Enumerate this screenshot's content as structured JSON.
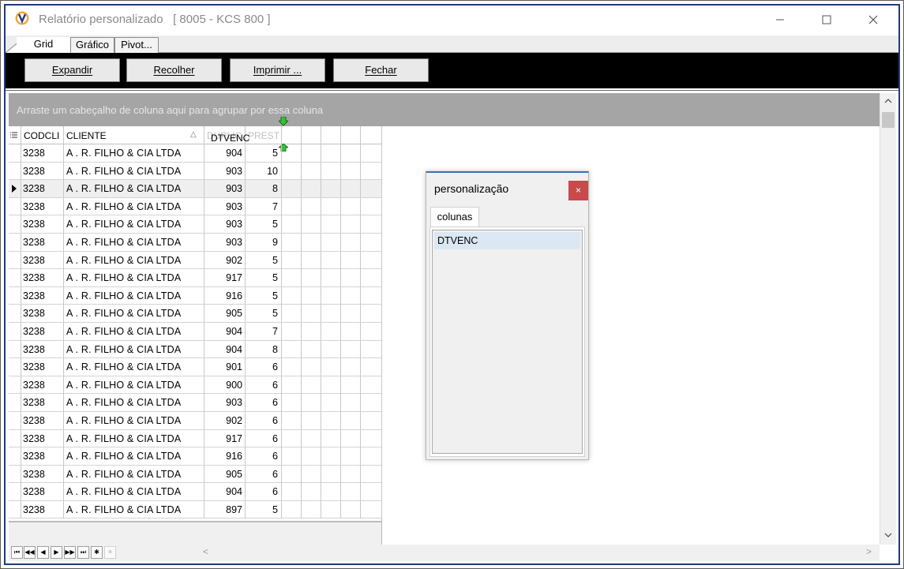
{
  "window": {
    "title": "Relatório personalizado   [ 8005 - KCS 800 ]",
    "controls": [
      "minimize",
      "maximize",
      "close"
    ]
  },
  "tabs": [
    {
      "label": "Grid",
      "active": true
    },
    {
      "label": "Gráfico",
      "active": false
    },
    {
      "label": "Pivot...",
      "active": false
    }
  ],
  "toolbar": {
    "expandir": "Expandir",
    "recolher": "Recolher",
    "imprimir": "Imprimir ...",
    "fechar": "Fechar"
  },
  "group_panel": {
    "hint": "Arraste um cabeçalho de coluna aqui para agrupar por essa coluna"
  },
  "grid": {
    "columns": {
      "codcli": "CODCLI",
      "cliente": "CLIENTE",
      "duplic": "DUPLIC",
      "prest": "PREST"
    },
    "dragging_column": "DTVENC",
    "current_row_index": 2,
    "rows": [
      {
        "codcli": "3238",
        "cliente": "A . R.  FILHO & CIA LTDA",
        "duplic": "904",
        "prest": "5"
      },
      {
        "codcli": "3238",
        "cliente": "A . R.  FILHO & CIA LTDA",
        "duplic": "903",
        "prest": "10"
      },
      {
        "codcli": "3238",
        "cliente": "A . R.  FILHO & CIA LTDA",
        "duplic": "903",
        "prest": "8"
      },
      {
        "codcli": "3238",
        "cliente": "A . R.  FILHO & CIA LTDA",
        "duplic": "903",
        "prest": "7"
      },
      {
        "codcli": "3238",
        "cliente": "A . R.  FILHO & CIA LTDA",
        "duplic": "903",
        "prest": "5"
      },
      {
        "codcli": "3238",
        "cliente": "A . R.  FILHO & CIA LTDA",
        "duplic": "903",
        "prest": "9"
      },
      {
        "codcli": "3238",
        "cliente": "A . R.  FILHO & CIA LTDA",
        "duplic": "902",
        "prest": "5"
      },
      {
        "codcli": "3238",
        "cliente": "A . R.  FILHO & CIA LTDA",
        "duplic": "917",
        "prest": "5"
      },
      {
        "codcli": "3238",
        "cliente": "A . R.  FILHO & CIA LTDA",
        "duplic": "916",
        "prest": "5"
      },
      {
        "codcli": "3238",
        "cliente": "A . R.  FILHO & CIA LTDA",
        "duplic": "905",
        "prest": "5"
      },
      {
        "codcli": "3238",
        "cliente": "A . R.  FILHO & CIA LTDA",
        "duplic": "904",
        "prest": "7"
      },
      {
        "codcli": "3238",
        "cliente": "A . R.  FILHO & CIA LTDA",
        "duplic": "904",
        "prest": "8"
      },
      {
        "codcli": "3238",
        "cliente": "A . R.  FILHO & CIA LTDA",
        "duplic": "901",
        "prest": "6"
      },
      {
        "codcli": "3238",
        "cliente": "A . R.  FILHO & CIA LTDA",
        "duplic": "900",
        "prest": "6"
      },
      {
        "codcli": "3238",
        "cliente": "A . R.  FILHO & CIA LTDA",
        "duplic": "903",
        "prest": "6"
      },
      {
        "codcli": "3238",
        "cliente": "A . R.  FILHO & CIA LTDA",
        "duplic": "902",
        "prest": "6"
      },
      {
        "codcli": "3238",
        "cliente": "A . R.  FILHO & CIA LTDA",
        "duplic": "917",
        "prest": "6"
      },
      {
        "codcli": "3238",
        "cliente": "A . R.  FILHO & CIA LTDA",
        "duplic": "916",
        "prest": "6"
      },
      {
        "codcli": "3238",
        "cliente": "A . R.  FILHO & CIA LTDA",
        "duplic": "905",
        "prest": "6"
      },
      {
        "codcli": "3238",
        "cliente": "A . R.  FILHO & CIA LTDA",
        "duplic": "904",
        "prest": "6"
      },
      {
        "codcli": "3238",
        "cliente": "A . R.  FILHO & CIA LTDA",
        "duplic": "897",
        "prest": "5"
      }
    ]
  },
  "navigator": {
    "buttons": [
      {
        "name": "first-page",
        "glyph": "⏮"
      },
      {
        "name": "prev-page",
        "glyph": "◀◀"
      },
      {
        "name": "prev-record",
        "glyph": "◀"
      },
      {
        "name": "next-record",
        "glyph": "▶"
      },
      {
        "name": "next-page",
        "glyph": "▶▶"
      },
      {
        "name": "last-page",
        "glyph": "⏭"
      },
      {
        "name": "insert-record",
        "glyph": "✱"
      },
      {
        "name": "cancel-edit",
        "glyph": "✳"
      }
    ]
  },
  "dialog": {
    "title": "personalização",
    "close_glyph": "×",
    "tab_label": "colunas",
    "items": [
      "DTVENC"
    ]
  },
  "colors": {
    "toolbar_bg": "#000000",
    "group_panel_bg": "#a5a5a5",
    "dialog_close_bg": "#c84a4a",
    "selected_item_bg": "#dbe8f3",
    "window_frame": "#1f3c78"
  }
}
